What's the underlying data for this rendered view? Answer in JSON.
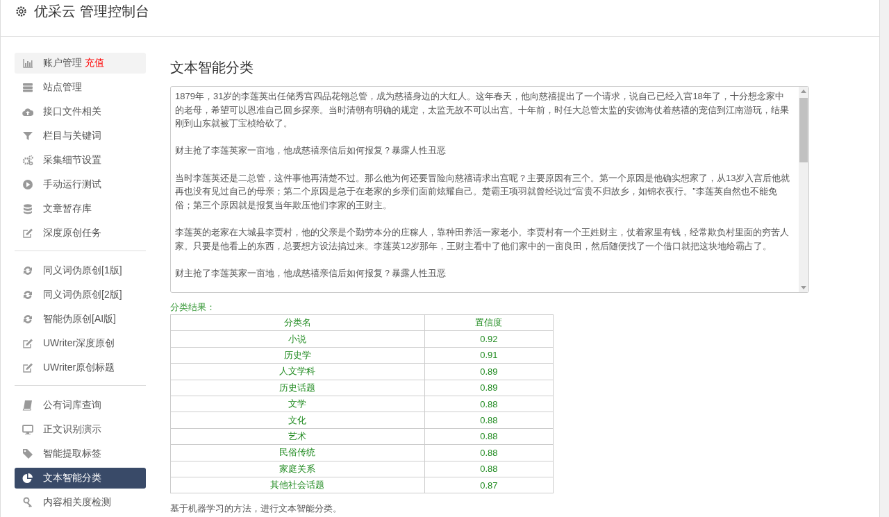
{
  "header": {
    "title": "优采云 管理控制台"
  },
  "sidebar": {
    "groups": [
      [
        {
          "label": "账户管理",
          "badge": "充值",
          "kind": "chart",
          "highlighted": true,
          "selected": false
        },
        {
          "label": "站点管理",
          "kind": "server",
          "highlighted": false,
          "selected": false
        },
        {
          "label": "接口文件相关",
          "kind": "cloud",
          "highlighted": false,
          "selected": false
        },
        {
          "label": "栏目与关键词",
          "kind": "filter",
          "highlighted": false,
          "selected": false
        },
        {
          "label": "采集细节设置",
          "kind": "gears",
          "highlighted": false,
          "selected": false
        },
        {
          "label": "手动运行测试",
          "kind": "play",
          "highlighted": false,
          "selected": false
        },
        {
          "label": "文章暂存库",
          "kind": "database",
          "highlighted": false,
          "selected": false
        },
        {
          "label": "深度原创任务",
          "kind": "edit",
          "highlighted": false,
          "selected": false
        }
      ],
      [
        {
          "label": "同义词伪原创[1版]",
          "kind": "refresh",
          "highlighted": false,
          "selected": false
        },
        {
          "label": "同义词伪原创[2版]",
          "kind": "refresh",
          "highlighted": false,
          "selected": false
        },
        {
          "label": "智能伪原创[AI版]",
          "kind": "refresh",
          "highlighted": false,
          "selected": false
        },
        {
          "label": "UWriter深度原创",
          "kind": "edit",
          "highlighted": false,
          "selected": false
        },
        {
          "label": "UWriter原创标题",
          "kind": "edit",
          "highlighted": false,
          "selected": false
        }
      ],
      [
        {
          "label": "公有词库查询",
          "kind": "book",
          "highlighted": false,
          "selected": false
        },
        {
          "label": "正文识别演示",
          "kind": "monitor",
          "highlighted": false,
          "selected": false
        },
        {
          "label": "智能提取标签",
          "kind": "tag",
          "highlighted": false,
          "selected": false
        },
        {
          "label": "文本智能分类",
          "kind": "pie",
          "highlighted": false,
          "selected": true
        },
        {
          "label": "内容相关度检测",
          "kind": "key",
          "highlighted": false,
          "selected": false
        }
      ]
    ]
  },
  "main": {
    "title": "文本智能分类",
    "source_text": [
      "1879年，31岁的李莲英出任储秀宫四品花翎总管，成为慈禧身边的大红人。这年春天，他向慈禧提出了一个请求，说自己已经入宫18年了，十分想念家中的老母，希望可以恩准自己回乡探亲。当时清朝有明确的规定，太监无故不可以出宫。十年前，时任大总管太监的安德海仗着慈禧的宠信到江南游玩，结果刚到山东就被丁宝桢给砍了。",
      "财主抢了李莲英家一亩地，他成慈禧亲信后如何报复？暴露人性丑恶",
      "当时李莲英还是二总管，这件事他再清楚不过。那么他为何还要冒险向慈禧请求出宫呢？主要原因有三个。第一个原因是他确实想家了，从13岁入宫后他就再也没有见过自己的母亲；第二个原因是急于在老家的乡亲们面前炫耀自己。楚霸王项羽就曾经说过“富贵不归故乡，如锦衣夜行。”李莲英自然也不能免俗；第三个原因就是报复当年欺压他们李家的王财主。",
      "李莲英的老家在大城县李贾村，他的父亲是个勤劳本分的庄稼人，靠种田养活一家老小。李贾村有一个王姓财主，仗着家里有钱，经常欺负村里面的穷苦人家。只要是他看上的东西，总要想方设法搞过来。李莲英12岁那年，王财主看中了他们家中的一亩良田，然后随便找了一个借口就把这块地给霸占了。",
      "财主抢了李莲英家一亩地，他成慈禧亲信后如何报复？暴露人性丑恶"
    ],
    "result_label": "分类结果：",
    "table": {
      "columns": [
        "分类名",
        "置信度"
      ],
      "rows": [
        [
          "小说",
          "0.92"
        ],
        [
          "历史学",
          "0.91"
        ],
        [
          "人文学科",
          "0.89"
        ],
        [
          "历史话题",
          "0.89"
        ],
        [
          "文学",
          "0.88"
        ],
        [
          "文化",
          "0.88"
        ],
        [
          "艺术",
          "0.88"
        ],
        [
          "民俗传统",
          "0.88"
        ],
        [
          "家庭关系",
          "0.88"
        ],
        [
          "其他社会话题",
          "0.87"
        ]
      ]
    },
    "note": "基于机器学习的方法，进行文本智能分类。"
  }
}
